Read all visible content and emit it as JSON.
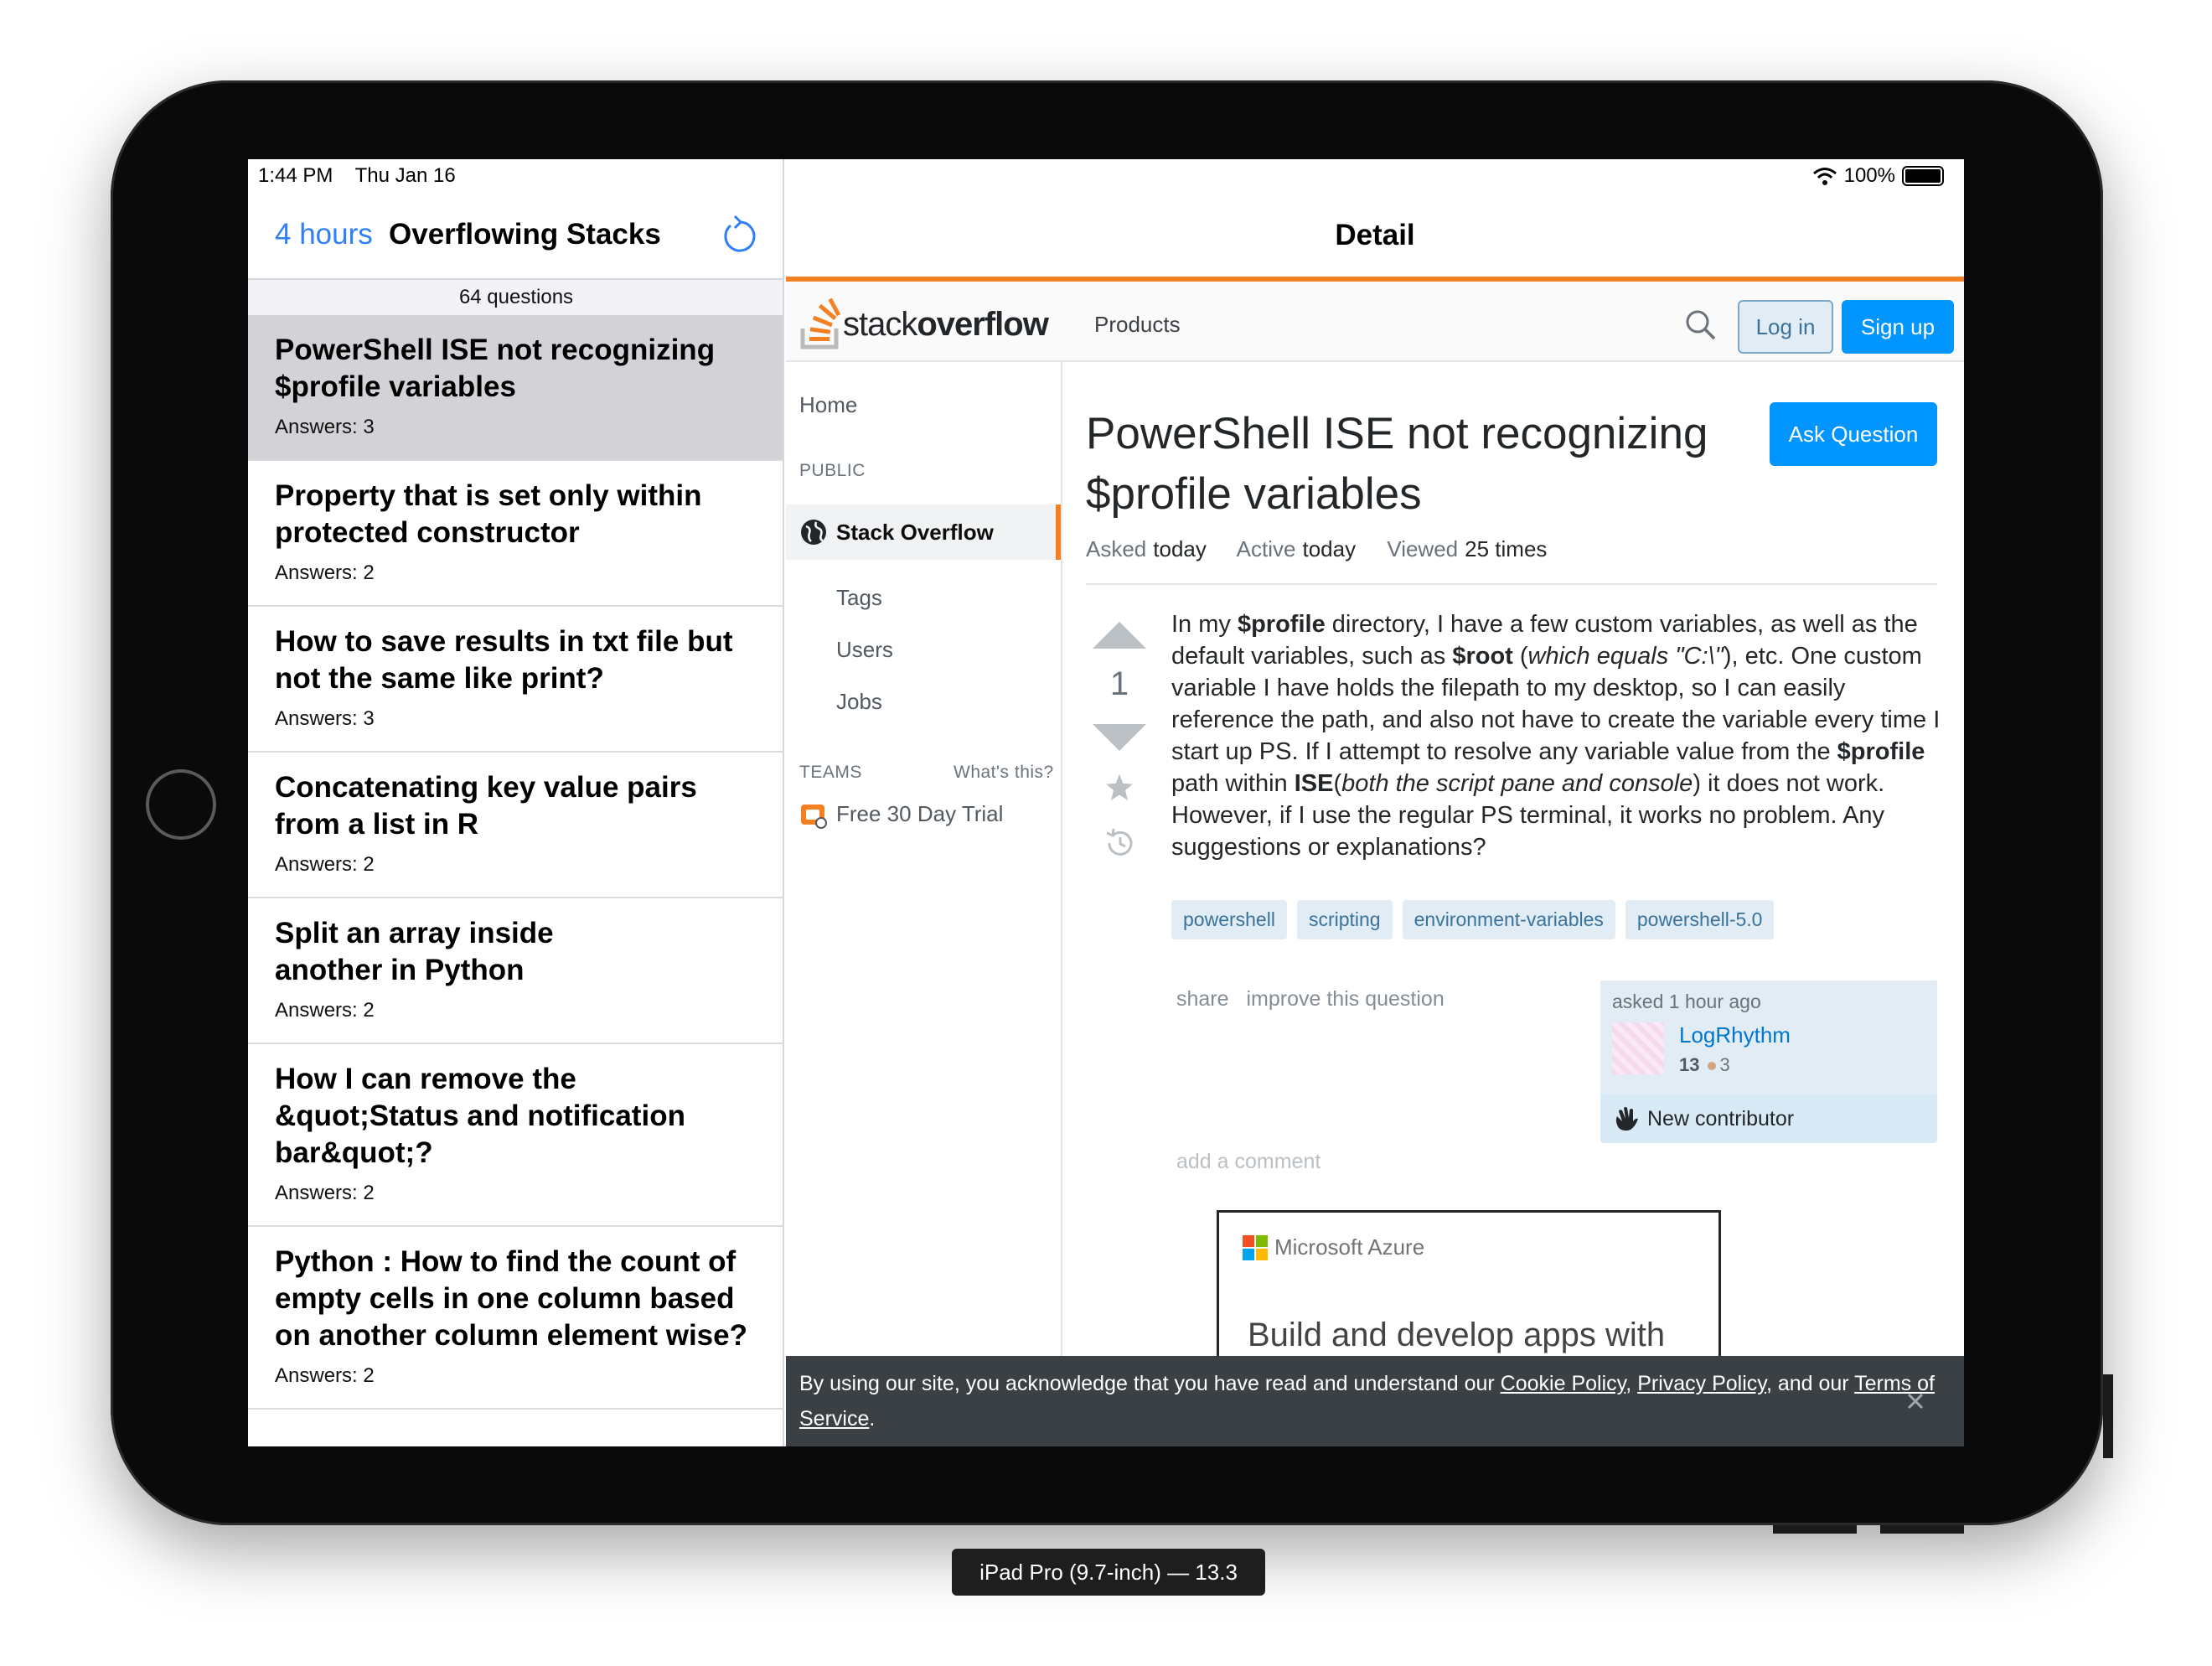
{
  "status_bar": {
    "time": "1:44 PM",
    "date": "Thu Jan 16",
    "battery": "100%"
  },
  "left_pane": {
    "back_label": "4 hours",
    "title": "Overflowing Stacks",
    "count_label": "64 questions",
    "questions": [
      {
        "title": "PowerShell ISE not recognizing $profile variables",
        "answers": "Answers: 3"
      },
      {
        "title": "Property that is set only within protected constructor",
        "answers": "Answers: 2"
      },
      {
        "title": "How to save results in txt file but not the same like print?",
        "answers": "Answers: 3"
      },
      {
        "title": "Concatenating key value pairs from a list in R",
        "answers": "Answers: 2"
      },
      {
        "title": "Split an array inside another in Python",
        "answers": "Answers: 2"
      },
      {
        "title": "How I can remove the &quot;Status and notification bar&quot;?",
        "answers": "Answers: 2"
      },
      {
        "title": "Python : How to find the count of empty cells in one column based on another column element wise?",
        "answers": "Answers: 2"
      }
    ]
  },
  "detail": {
    "nav_title": "Detail",
    "topbar": {
      "logo_a": "stack",
      "logo_b": "overflow",
      "products": "Products",
      "login": "Log in",
      "signup": "Sign up"
    },
    "sidebar": {
      "home": "Home",
      "public": "PUBLIC",
      "stack_overflow": "Stack Overflow",
      "tags": "Tags",
      "users": "Users",
      "jobs": "Jobs",
      "teams": "TEAMS",
      "whats_this": "What's this?",
      "trial": "Free 30 Day Trial"
    },
    "question": {
      "title": "PowerShell ISE not recognizing $profile variables",
      "ask_button": "Ask Question",
      "asked_label": "Asked",
      "asked_value": "today",
      "active_label": "Active",
      "active_value": "today",
      "viewed_label": "Viewed",
      "viewed_value": "25 times",
      "votes": "1",
      "body": {
        "p1": "In my ",
        "b1": "$profile",
        "p2": " directory, I have a few custom variables, as well as the default variables, such as ",
        "b2": "$root",
        "p3": " (",
        "i1": "which equals \"C:\\\"",
        "p4": "), etc. One custom variable I have holds the filepath to my desktop, so I can easily reference the path, and also not have to create the variable every time I start up PS. If I attempt to resolve any variable value from the ",
        "b3": "$profile",
        "p5": " path within ",
        "b4": "ISE",
        "p6": "(",
        "i2": "both the script pane and console",
        "p7": ") it does not work. However, if I use the regular PS terminal, it works no problem. Any suggestions or explanations?"
      },
      "tags": [
        "powershell",
        "scripting",
        "environment-variables",
        "powershell-5.0"
      ],
      "share": "share",
      "improve": "improve this question",
      "asked_time": "asked 1 hour ago",
      "author": "LogRhythm",
      "rep": "13",
      "bronze": "3",
      "new_contributor": "New contributor",
      "add_comment": "add a comment"
    },
    "ad": {
      "brand": "Microsoft Azure",
      "headline": "Build and develop apps with"
    },
    "cookie": {
      "text1": "By using our site, you acknowledge that you have read and understand our ",
      "link1": "Cookie Policy",
      "sep1": ", ",
      "link2": "Privacy Policy",
      "text2": ", and our ",
      "link3": "Terms of Service",
      "text3": "."
    }
  },
  "device_label": "iPad Pro (9.7-inch) — 13.3",
  "colors": {
    "accent_blue": "#2f7ff5",
    "so_orange": "#f48024",
    "so_button": "#0095ff",
    "tag_bg": "#e1ecf4",
    "tag_text": "#39739d"
  }
}
